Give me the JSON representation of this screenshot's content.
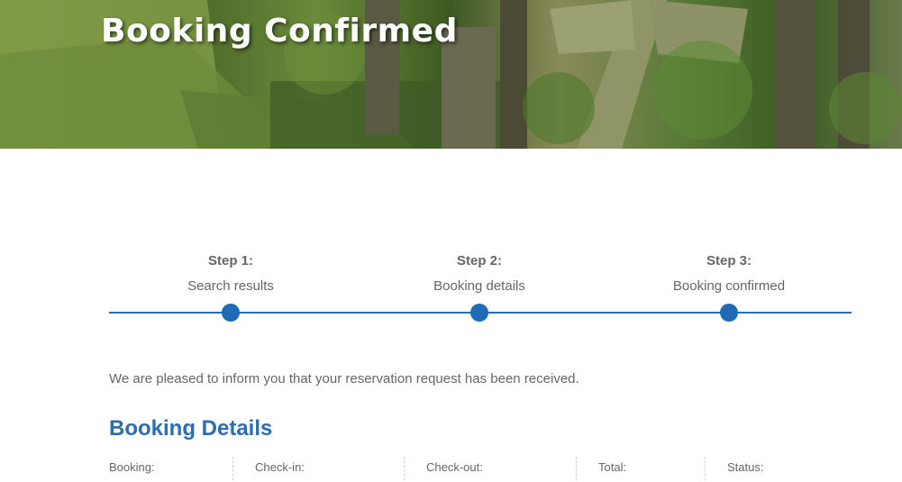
{
  "hero": {
    "title": "Booking Confirmed"
  },
  "steps": [
    {
      "label": "Step 1:",
      "description": "Search results"
    },
    {
      "label": "Step 2:",
      "description": "Booking details"
    },
    {
      "label": "Step 3:",
      "description": "Booking confirmed"
    }
  ],
  "intro_text": "We are pleased to inform you that your reservation request has been received.",
  "booking_details": {
    "heading": "Booking Details",
    "columns": [
      "Booking:",
      "Check-in:",
      "Check-out:",
      "Total:",
      "Status:"
    ]
  },
  "colors": {
    "accent": "#2a6db0",
    "step_dot": "#1f6cb5",
    "text": "#666666"
  }
}
